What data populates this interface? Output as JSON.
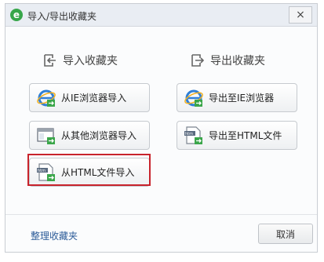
{
  "window": {
    "title": "导入/导出收藏夹",
    "close_symbol": "×"
  },
  "import_section": {
    "title": "导入收藏夹",
    "buttons": [
      {
        "label": "从IE浏览器导入",
        "icon": "ie-browser-icon"
      },
      {
        "label": "从其他浏览器导入",
        "icon": "browser-window-icon"
      },
      {
        "label": "从HTML文件导入",
        "icon": "html-file-icon"
      }
    ]
  },
  "export_section": {
    "title": "导出收藏夹",
    "buttons": [
      {
        "label": "导出至IE浏览器",
        "icon": "ie-browser-icon"
      },
      {
        "label": "导出至HTML文件",
        "icon": "html-file-icon"
      }
    ]
  },
  "footer": {
    "organize_link": "整理收藏夹",
    "cancel_label": "取消"
  },
  "colors": {
    "highlight": "#c8232c",
    "link": "#2d5c99",
    "title_bar": "#e9edf3"
  }
}
